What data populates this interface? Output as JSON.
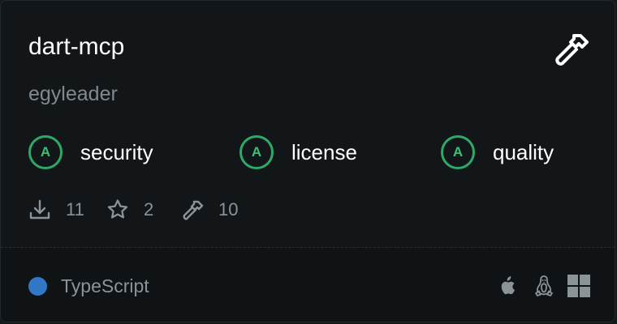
{
  "card": {
    "name": "dart-mcp",
    "owner": "egyleader",
    "tool_icon": "hammer-icon",
    "grades": [
      {
        "grade": "A",
        "label": "security"
      },
      {
        "grade": "A",
        "label": "license"
      },
      {
        "grade": "A",
        "label": "quality"
      }
    ],
    "stats": {
      "downloads": "11",
      "stars": "2",
      "tools": "10"
    },
    "language": {
      "name": "TypeScript",
      "color": "#3178c6"
    },
    "platforms": [
      "apple-icon",
      "linux-icon",
      "windows-icon"
    ]
  },
  "colors": {
    "grade_green": "#2ea867",
    "background": "#121618",
    "muted_text": "#8a9497"
  }
}
